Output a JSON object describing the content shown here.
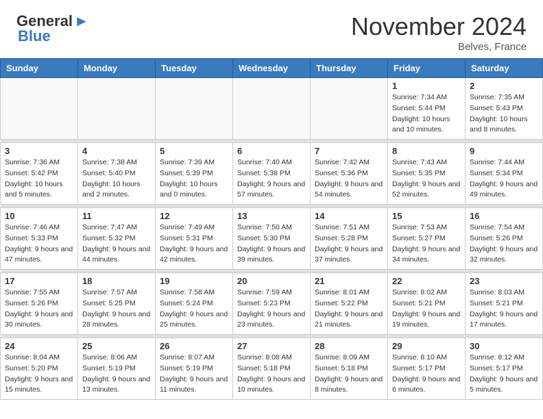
{
  "header": {
    "logo_line1": "General",
    "logo_line2": "Blue",
    "month_title": "November 2024",
    "location": "Belves, France"
  },
  "weekdays": [
    "Sunday",
    "Monday",
    "Tuesday",
    "Wednesday",
    "Thursday",
    "Friday",
    "Saturday"
  ],
  "weeks": [
    [
      {
        "day": "",
        "info": ""
      },
      {
        "day": "",
        "info": ""
      },
      {
        "day": "",
        "info": ""
      },
      {
        "day": "",
        "info": ""
      },
      {
        "day": "",
        "info": ""
      },
      {
        "day": "1",
        "info": "Sunrise: 7:34 AM\nSunset: 5:44 PM\nDaylight: 10 hours and 10 minutes."
      },
      {
        "day": "2",
        "info": "Sunrise: 7:35 AM\nSunset: 5:43 PM\nDaylight: 10 hours and 8 minutes."
      }
    ],
    [
      {
        "day": "3",
        "info": "Sunrise: 7:36 AM\nSunset: 5:42 PM\nDaylight: 10 hours and 5 minutes."
      },
      {
        "day": "4",
        "info": "Sunrise: 7:38 AM\nSunset: 5:40 PM\nDaylight: 10 hours and 2 minutes."
      },
      {
        "day": "5",
        "info": "Sunrise: 7:39 AM\nSunset: 5:39 PM\nDaylight: 10 hours and 0 minutes."
      },
      {
        "day": "6",
        "info": "Sunrise: 7:40 AM\nSunset: 5:38 PM\nDaylight: 9 hours and 57 minutes."
      },
      {
        "day": "7",
        "info": "Sunrise: 7:42 AM\nSunset: 5:36 PM\nDaylight: 9 hours and 54 minutes."
      },
      {
        "day": "8",
        "info": "Sunrise: 7:43 AM\nSunset: 5:35 PM\nDaylight: 9 hours and 52 minutes."
      },
      {
        "day": "9",
        "info": "Sunrise: 7:44 AM\nSunset: 5:34 PM\nDaylight: 9 hours and 49 minutes."
      }
    ],
    [
      {
        "day": "10",
        "info": "Sunrise: 7:46 AM\nSunset: 5:33 PM\nDaylight: 9 hours and 47 minutes."
      },
      {
        "day": "11",
        "info": "Sunrise: 7:47 AM\nSunset: 5:32 PM\nDaylight: 9 hours and 44 minutes."
      },
      {
        "day": "12",
        "info": "Sunrise: 7:49 AM\nSunset: 5:31 PM\nDaylight: 9 hours and 42 minutes."
      },
      {
        "day": "13",
        "info": "Sunrise: 7:50 AM\nSunset: 5:30 PM\nDaylight: 9 hours and 39 minutes."
      },
      {
        "day": "14",
        "info": "Sunrise: 7:51 AM\nSunset: 5:28 PM\nDaylight: 9 hours and 37 minutes."
      },
      {
        "day": "15",
        "info": "Sunrise: 7:53 AM\nSunset: 5:27 PM\nDaylight: 9 hours and 34 minutes."
      },
      {
        "day": "16",
        "info": "Sunrise: 7:54 AM\nSunset: 5:26 PM\nDaylight: 9 hours and 32 minutes."
      }
    ],
    [
      {
        "day": "17",
        "info": "Sunrise: 7:55 AM\nSunset: 5:26 PM\nDaylight: 9 hours and 30 minutes."
      },
      {
        "day": "18",
        "info": "Sunrise: 7:57 AM\nSunset: 5:25 PM\nDaylight: 9 hours and 28 minutes."
      },
      {
        "day": "19",
        "info": "Sunrise: 7:58 AM\nSunset: 5:24 PM\nDaylight: 9 hours and 25 minutes."
      },
      {
        "day": "20",
        "info": "Sunrise: 7:59 AM\nSunset: 5:23 PM\nDaylight: 9 hours and 23 minutes."
      },
      {
        "day": "21",
        "info": "Sunrise: 8:01 AM\nSunset: 5:22 PM\nDaylight: 9 hours and 21 minutes."
      },
      {
        "day": "22",
        "info": "Sunrise: 8:02 AM\nSunset: 5:21 PM\nDaylight: 9 hours and 19 minutes."
      },
      {
        "day": "23",
        "info": "Sunrise: 8:03 AM\nSunset: 5:21 PM\nDaylight: 9 hours and 17 minutes."
      }
    ],
    [
      {
        "day": "24",
        "info": "Sunrise: 8:04 AM\nSunset: 5:20 PM\nDaylight: 9 hours and 15 minutes."
      },
      {
        "day": "25",
        "info": "Sunrise: 8:06 AM\nSunset: 5:19 PM\nDaylight: 9 hours and 13 minutes."
      },
      {
        "day": "26",
        "info": "Sunrise: 8:07 AM\nSunset: 5:19 PM\nDaylight: 9 hours and 11 minutes."
      },
      {
        "day": "27",
        "info": "Sunrise: 8:08 AM\nSunset: 5:18 PM\nDaylight: 9 hours and 10 minutes."
      },
      {
        "day": "28",
        "info": "Sunrise: 8:09 AM\nSunset: 5:18 PM\nDaylight: 9 hours and 8 minutes."
      },
      {
        "day": "29",
        "info": "Sunrise: 8:10 AM\nSunset: 5:17 PM\nDaylight: 9 hours and 6 minutes."
      },
      {
        "day": "30",
        "info": "Sunrise: 8:12 AM\nSunset: 5:17 PM\nDaylight: 9 hours and 5 minutes."
      }
    ]
  ]
}
